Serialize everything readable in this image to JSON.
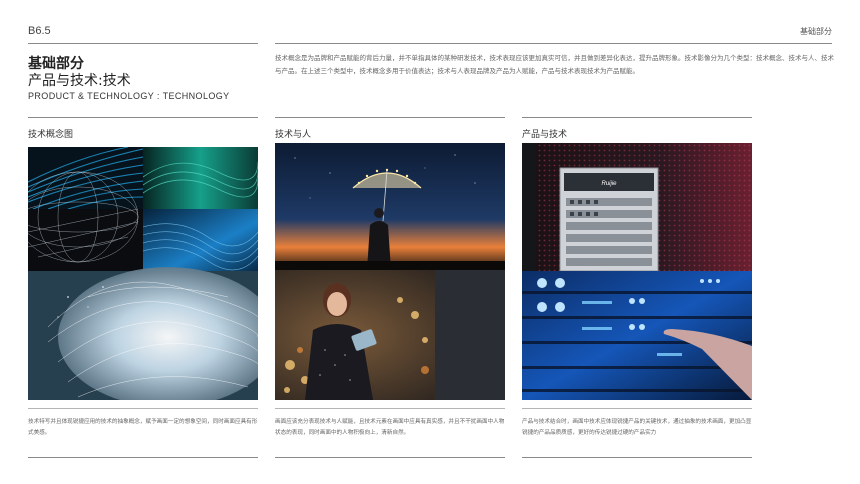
{
  "header": {
    "page_code": "B6.5",
    "section_tag": "基础部分",
    "title_cn_1": "基础部分",
    "title_cn_2": "产品与技术:技术",
    "title_en": "PRODUCT & TECHNOLOGY : TECHNOLOGY",
    "intro": "技术概念是为品牌和产品赋能的背后力量，并不单指具体的某种研发技术，技术表现应该更加真实可信，并且做到差异化表达，提升品牌形象。技术影像分为几个类型：技术概念、技术与人、技术与产品。在上述三个类型中，技术概念多用于价值表达；技术与人表现品牌及产品为人赋能，产品与技术表现技术为产品赋能。"
  },
  "columns": [
    {
      "title": "技术概念图",
      "caption": "技术特写并且体现锐捷应用的技术的抽象概念，赋予画面一定的想象空间，同时画面应具有形式美感。"
    },
    {
      "title": "技术与人",
      "caption": "画面应该充分表现技术与人赋能，且技术元素在画面中应具有真实感，并且不干扰画面中人物状态的表现，同时画面中的人物积极向上，清新自然。"
    },
    {
      "title": "产品与技术",
      "caption": "产品与技术结合时，画面中技术应体现锐捷产品的关键技术，通过抽象的技术画面，更加凸显锐捷的产品品质质感，更好的传达锐捷过硬的产品实力"
    }
  ],
  "images": {
    "product_brand_logo": "Ruijie"
  }
}
